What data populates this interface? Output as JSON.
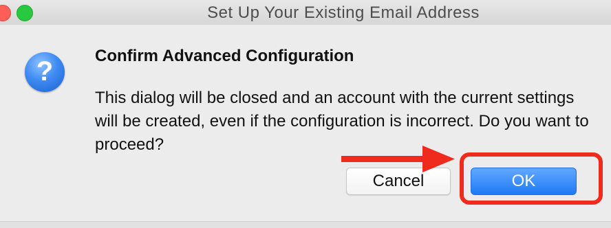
{
  "window": {
    "title": "Set Up Your Existing Email Address"
  },
  "dialog": {
    "icon": "question-icon",
    "heading": "Confirm Advanced Configuration",
    "message": "This dialog will be closed and an account with the current settings will be created, even if the configuration is incorrect. Do you want to proceed?",
    "buttons": {
      "cancel_label": "Cancel",
      "ok_label": "OK"
    }
  },
  "annotation": {
    "highlight_color": "#ef2b1d",
    "arrow_color": "#ef2b1d"
  }
}
